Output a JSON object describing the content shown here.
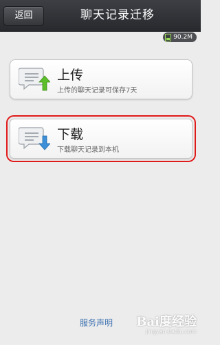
{
  "header": {
    "back_label": "返回",
    "title": "聊天记录迁移"
  },
  "storage": {
    "value": "90.2M"
  },
  "options": [
    {
      "title": "上传",
      "description": "上传的聊天记录可保存7天",
      "arrow": "up",
      "arrow_color": "#5cbf2a"
    },
    {
      "title": "下载",
      "description": "下载聊天记录到本机",
      "arrow": "down",
      "arrow_color": "#3c8fd8"
    }
  ],
  "footer": {
    "service_link": "服务声明"
  },
  "watermark": {
    "brand": "Bai度经验",
    "url": "jingyan.baidu.com"
  },
  "colors": {
    "highlight": "#e01919",
    "link": "#3a6fb0"
  }
}
